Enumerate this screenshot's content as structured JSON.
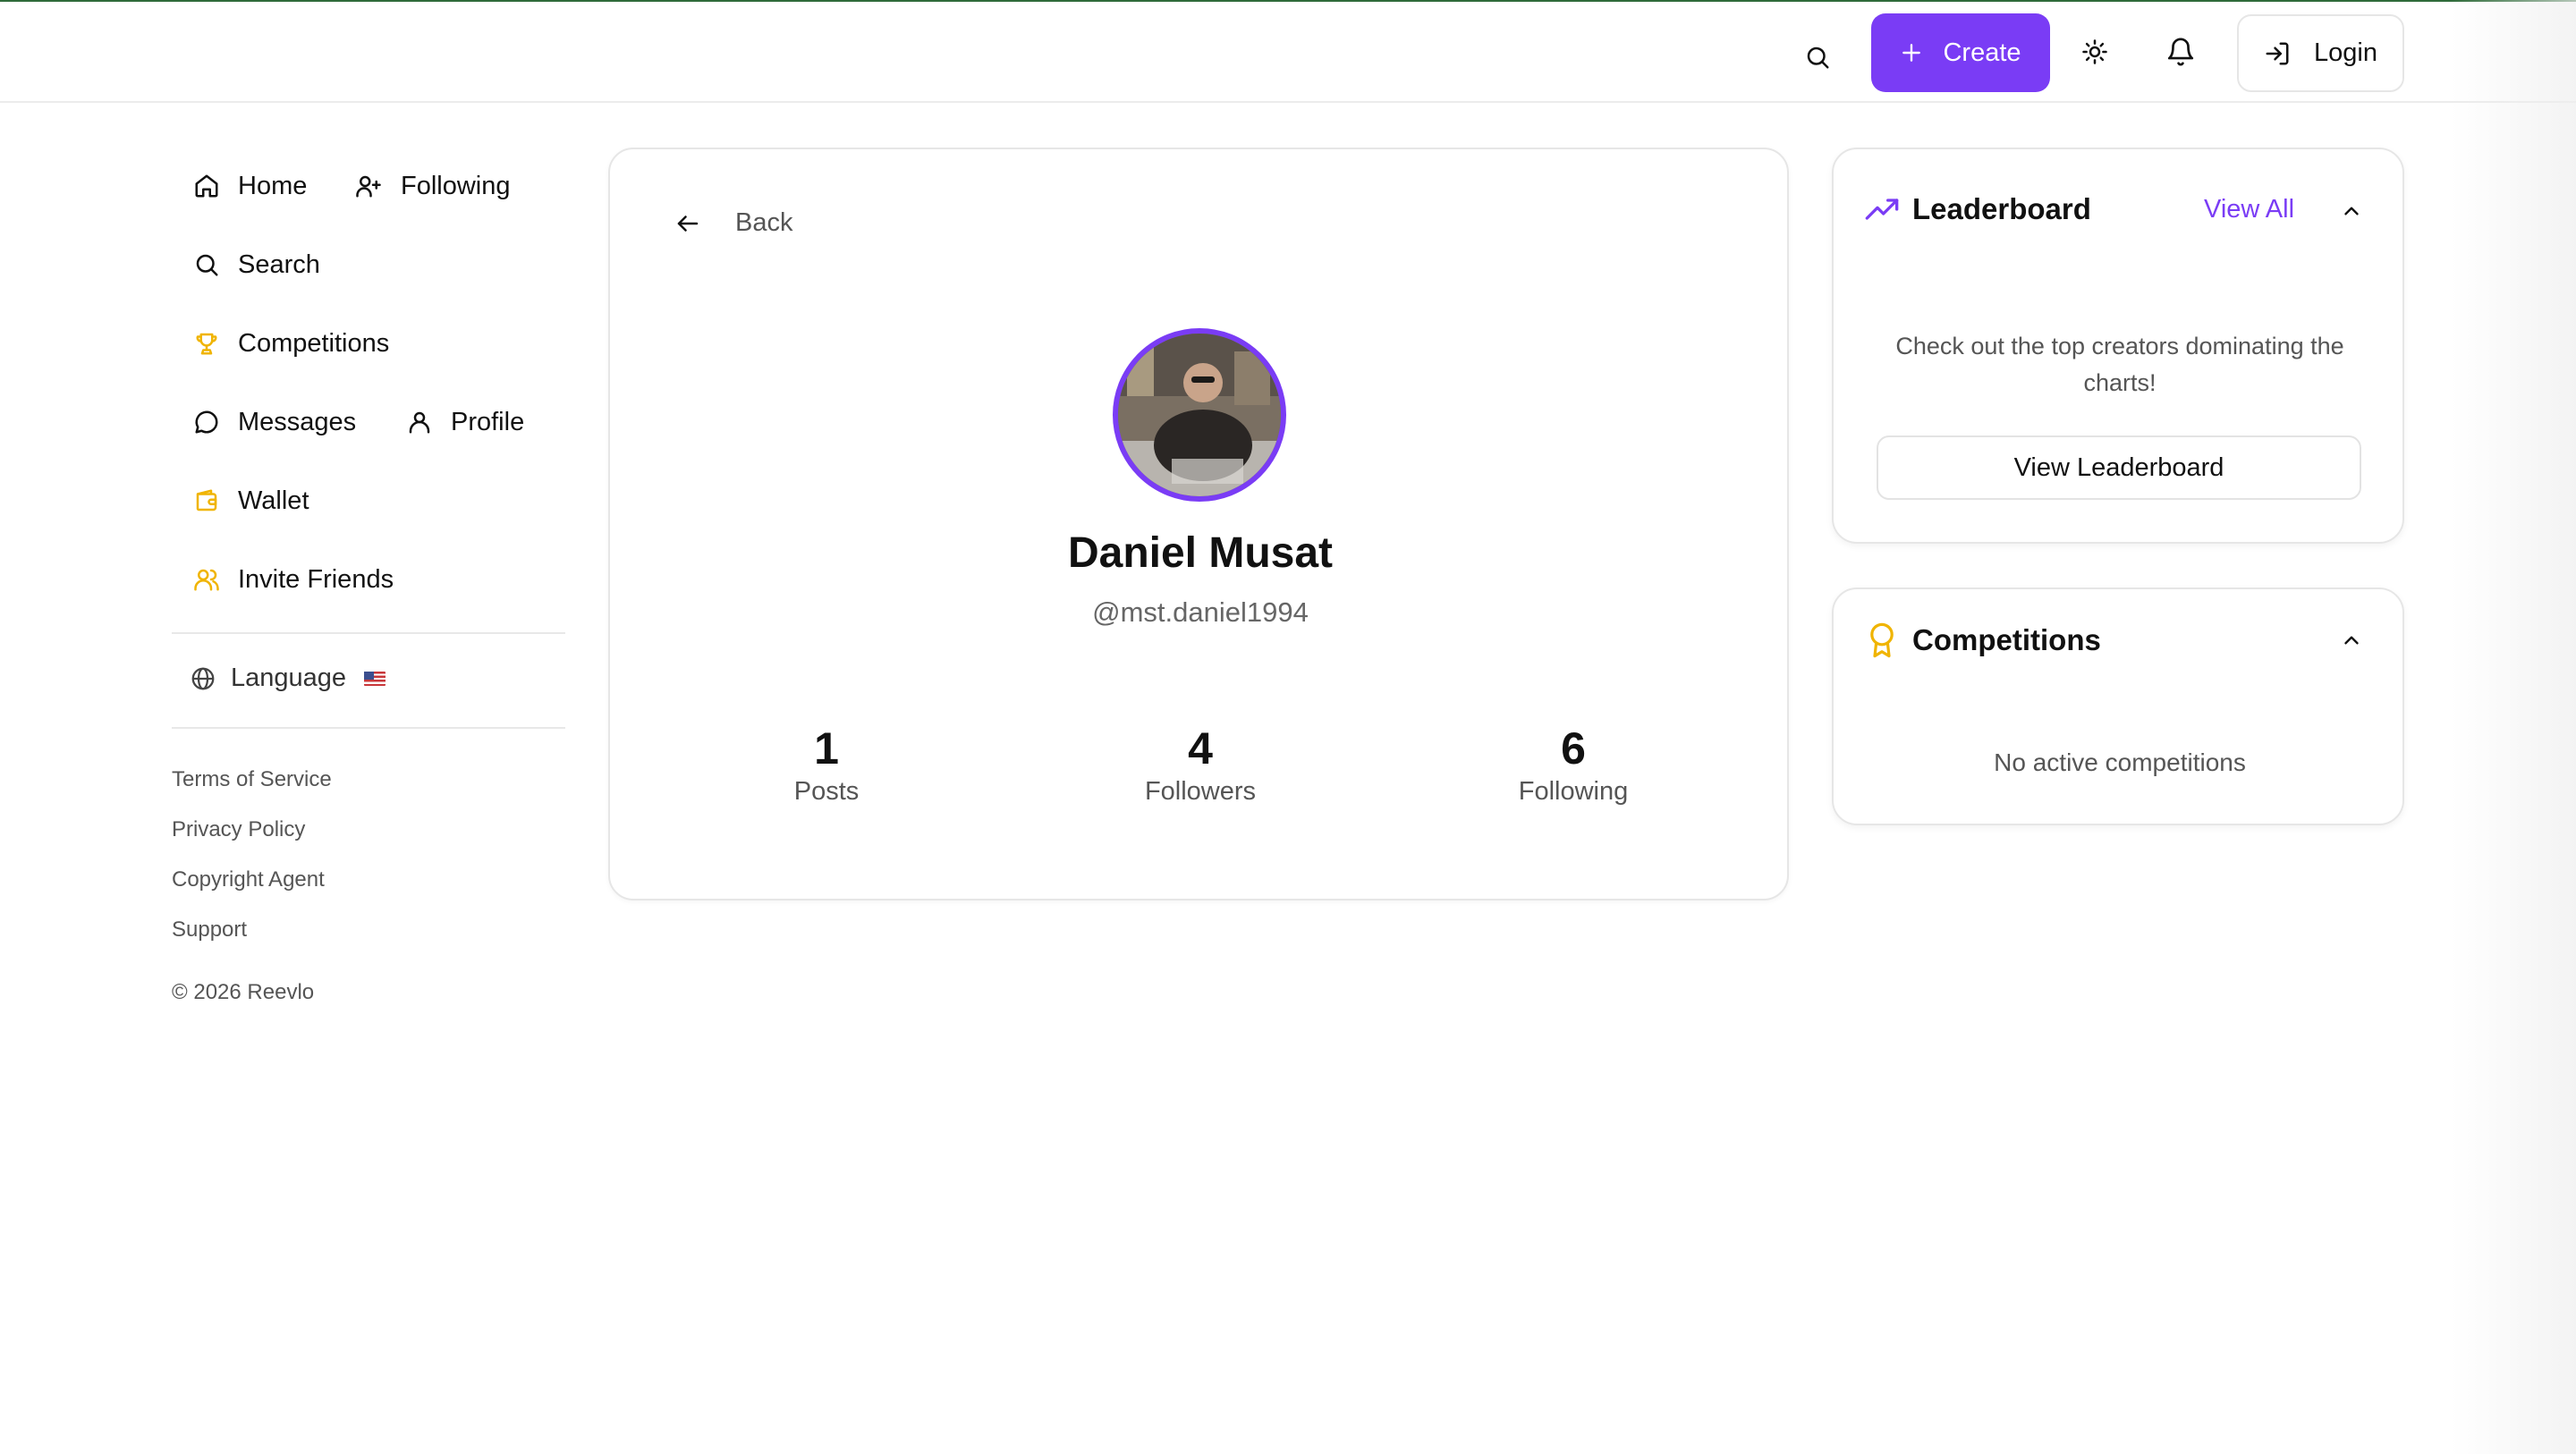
{
  "header": {
    "create_label": "Create",
    "login_label": "Login",
    "icons": [
      "search-icon",
      "plus-icon",
      "sun-icon",
      "bell-icon",
      "login-icon"
    ],
    "accent_color": "#7a3cf5"
  },
  "sidebar": {
    "items": [
      {
        "label": "Home",
        "icon": "home-icon"
      },
      {
        "label": "Following",
        "icon": "user-plus-icon"
      },
      {
        "label": "Search",
        "icon": "search-icon"
      },
      {
        "label": "Competitions",
        "icon": "trophy-icon"
      },
      {
        "label": "Messages",
        "icon": "message-icon"
      },
      {
        "label": "Profile",
        "icon": "user-icon"
      },
      {
        "label": "Wallet",
        "icon": "wallet-icon"
      },
      {
        "label": "Invite Friends",
        "icon": "users-icon"
      }
    ],
    "language_label": "Language",
    "footer_links": [
      "Terms of Service",
      "Privacy Policy",
      "Copyright Agent",
      "Support"
    ],
    "copyright": "© 2026 Reevlo"
  },
  "profile": {
    "back_label": "Back",
    "name": "Daniel Musat",
    "handle": "@mst.daniel1994",
    "stats": [
      {
        "value": "1",
        "label": "Posts"
      },
      {
        "value": "4",
        "label": "Followers"
      },
      {
        "value": "6",
        "label": "Following"
      }
    ]
  },
  "leaderboard": {
    "title": "Leaderboard",
    "view_all": "View All",
    "description": "Check out the top creators dominating the charts!",
    "button_label": "View Leaderboard"
  },
  "competitions": {
    "title": "Competitions",
    "empty_text": "No active competitions"
  }
}
